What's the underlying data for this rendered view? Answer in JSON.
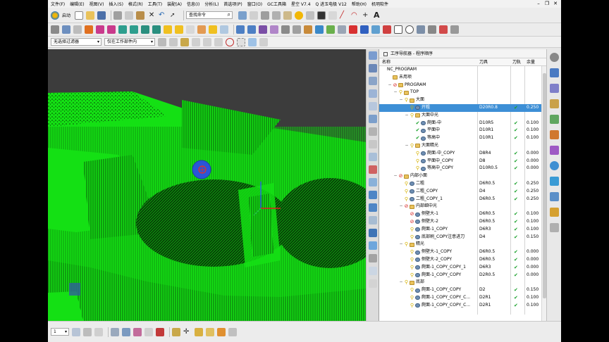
{
  "menu": {
    "items": [
      "文件(F)",
      "编辑(E)",
      "视图(V)",
      "插入(S)",
      "格式(R)",
      "工具(T)",
      "装配(A)",
      "信息(I)",
      "分析(L)",
      "首选项(P)",
      "窗口(O)",
      "GC工具箱",
      "星空 V7.4",
      "Q 进玉电极 V12",
      "帮助(H)",
      "机明软件"
    ],
    "window_controls": [
      "–",
      "❐",
      "✕"
    ]
  },
  "toolbar": {
    "start_label": "启动",
    "command_search_placeholder": "查找命令"
  },
  "filters": {
    "selection_filter": "无选择过滤器",
    "scope": "仅在工作部件内"
  },
  "navigator": {
    "title": "工序导航器 - 程序顺序",
    "columns": {
      "name": "名称",
      "tool": "刀具",
      "path": "刀轨",
      "stock": "余量"
    },
    "rows": [
      {
        "level": 0,
        "toggle": "",
        "status": "",
        "icon": "",
        "name": "NC_PROGRAM",
        "tool": "",
        "path": "",
        "stock": ""
      },
      {
        "level": 1,
        "toggle": "",
        "status": "",
        "icon": "folder",
        "name": "未用项",
        "tool": "",
        "path": "",
        "stock": ""
      },
      {
        "level": 1,
        "toggle": "−",
        "status": "no",
        "icon": "folder",
        "name": "PROGRAM",
        "tool": "",
        "path": "",
        "stock": ""
      },
      {
        "level": 2,
        "toggle": "−",
        "status": "key",
        "icon": "folder",
        "name": "TOP",
        "tool": "",
        "path": "",
        "stock": ""
      },
      {
        "level": 3,
        "toggle": "−",
        "status": "key",
        "icon": "folder",
        "name": "大面",
        "tool": "",
        "path": "",
        "stock": ""
      },
      {
        "level": 4,
        "toggle": "",
        "status": "key",
        "icon": "op",
        "name": "开粗",
        "tool": "D20R0.8",
        "path": "✔",
        "stock": "0.250",
        "selected": true
      },
      {
        "level": 4,
        "toggle": "−",
        "status": "key",
        "icon": "folder",
        "name": "大面中光",
        "tool": "",
        "path": "",
        "stock": ""
      },
      {
        "level": 5,
        "toggle": "",
        "status": "ok",
        "icon": "op",
        "name": "爬面-中",
        "tool": "D10R5",
        "path": "✔",
        "stock": "0.100"
      },
      {
        "level": 5,
        "toggle": "",
        "status": "ok",
        "icon": "op",
        "name": "平面中",
        "tool": "D10R1",
        "path": "✔",
        "stock": "0.100"
      },
      {
        "level": 5,
        "toggle": "",
        "status": "ok",
        "icon": "op",
        "name": "等高中",
        "tool": "D10R1",
        "path": "✔",
        "stock": "0.100"
      },
      {
        "level": 4,
        "toggle": "−",
        "status": "key",
        "icon": "folder",
        "name": "大面精光",
        "tool": "",
        "path": "",
        "stock": ""
      },
      {
        "level": 5,
        "toggle": "",
        "status": "key",
        "icon": "op",
        "name": "爬面-中_COPY",
        "tool": "D8R4",
        "path": "✔",
        "stock": "0.000"
      },
      {
        "level": 5,
        "toggle": "",
        "status": "key",
        "icon": "op",
        "name": "平面中_COPY",
        "tool": "D8",
        "path": "✔",
        "stock": "0.000"
      },
      {
        "level": 5,
        "toggle": "",
        "status": "key",
        "icon": "op",
        "name": "等高中_COPY",
        "tool": "D10R0.5",
        "path": "✔",
        "stock": "0.000"
      },
      {
        "level": 2,
        "toggle": "−",
        "status": "no",
        "icon": "folder",
        "name": "内部小面",
        "tool": "",
        "path": "",
        "stock": ""
      },
      {
        "level": 3,
        "toggle": "",
        "status": "key",
        "icon": "op",
        "name": "二粗",
        "tool": "D6R0.5",
        "path": "✔",
        "stock": "0.250"
      },
      {
        "level": 3,
        "toggle": "",
        "status": "key",
        "icon": "op",
        "name": "二粗_COPY",
        "tool": "D4",
        "path": "✔",
        "stock": "0.250"
      },
      {
        "level": 3,
        "toggle": "",
        "status": "key",
        "icon": "op",
        "name": "二粗_COPY_1",
        "tool": "D6R0.5",
        "path": "✔",
        "stock": "0.250"
      },
      {
        "level": 3,
        "toggle": "−",
        "status": "no",
        "icon": "folder",
        "name": "内部细中光",
        "tool": "",
        "path": "",
        "stock": ""
      },
      {
        "level": 4,
        "toggle": "",
        "status": "no",
        "icon": "op",
        "name": "侧壁大-1",
        "tool": "D6R0.5",
        "path": "✔",
        "stock": "0.100"
      },
      {
        "level": 4,
        "toggle": "",
        "status": "no",
        "icon": "op",
        "name": "侧壁大-2",
        "tool": "D6R0.5",
        "path": "✔",
        "stock": "0.100"
      },
      {
        "level": 4,
        "toggle": "",
        "status": "key",
        "icon": "op",
        "name": "爬面-1_COPY",
        "tool": "D6R3",
        "path": "✔",
        "stock": "0.100"
      },
      {
        "level": 4,
        "toggle": "",
        "status": "key",
        "icon": "op",
        "name": "底部刷_COPY注意进刀",
        "tool": "D4",
        "path": "✔",
        "stock": "0.150"
      },
      {
        "level": 3,
        "toggle": "−",
        "status": "key",
        "icon": "folder",
        "name": "精光",
        "tool": "",
        "path": "",
        "stock": ""
      },
      {
        "level": 4,
        "toggle": "",
        "status": "key",
        "icon": "op",
        "name": "侧壁大-1_COPY",
        "tool": "D6R0.5",
        "path": "✔",
        "stock": "0.000"
      },
      {
        "level": 4,
        "toggle": "",
        "status": "key",
        "icon": "op",
        "name": "侧壁大-2_COPY",
        "tool": "D6R0.5",
        "path": "✔",
        "stock": "0.000"
      },
      {
        "level": 4,
        "toggle": "",
        "status": "key",
        "icon": "op",
        "name": "爬面-1_COPY_COPY_1",
        "tool": "D6R3",
        "path": "✔",
        "stock": "0.000"
      },
      {
        "level": 4,
        "toggle": "",
        "status": "key",
        "icon": "op",
        "name": "爬面-1_COPY_COPY",
        "tool": "D2R0.5",
        "path": "✔",
        "stock": "0.000"
      },
      {
        "level": 3,
        "toggle": "−",
        "status": "key",
        "icon": "folder",
        "name": "底部",
        "tool": "",
        "path": "",
        "stock": ""
      },
      {
        "level": 4,
        "toggle": "",
        "status": "key",
        "icon": "op",
        "name": "爬面-1_COPY_COPY",
        "tool": "D2",
        "path": "✔",
        "stock": "0.150"
      },
      {
        "level": 4,
        "toggle": "",
        "status": "key",
        "icon": "op",
        "name": "爬面-1_COPY_COPY_C...",
        "tool": "D2R1",
        "path": "✔",
        "stock": "0.100"
      },
      {
        "level": 4,
        "toggle": "",
        "status": "key",
        "icon": "op",
        "name": "爬面-1_COPY_COPY_C...",
        "tool": "D2R1",
        "path": "✔",
        "stock": "0.100"
      }
    ]
  },
  "bottom": {
    "number_selector": "1"
  },
  "colors": {
    "model_green": "#14e014",
    "background_dark": "#3c3c3c",
    "selection_blue": "#3d8fd6",
    "check_green": "#19a12a"
  }
}
